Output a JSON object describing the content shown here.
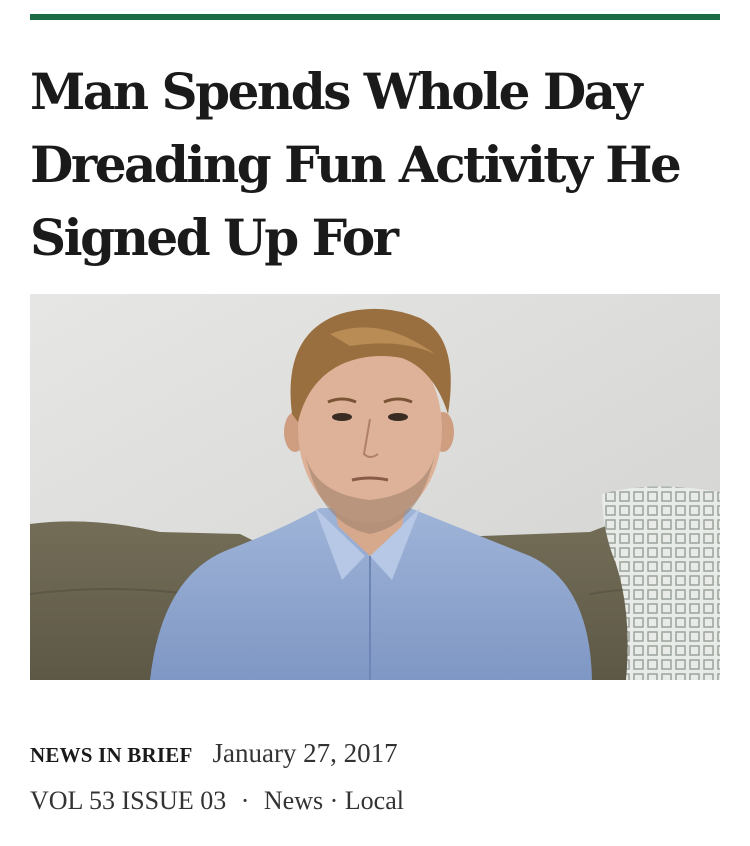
{
  "article": {
    "headline": "Man Spends Whole Day Dreading Fun Activity He Signed Up For",
    "section_label": "NEWS IN BRIEF",
    "date": "January 27, 2017",
    "issue": "VOL 53 ISSUE 03",
    "separator": "·",
    "categories": [
      "News",
      "Local"
    ],
    "category_separator": "·"
  },
  "colors": {
    "accent_rule": "#1e6b48",
    "text": "#1a1a1a"
  }
}
